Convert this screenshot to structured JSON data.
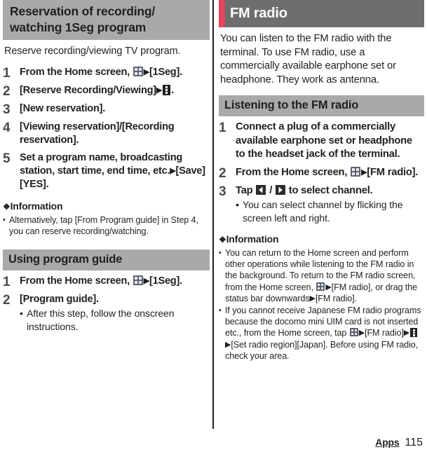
{
  "left": {
    "header": "Reservation of recording/ watching 1Seg program",
    "intro": "Reserve recording/viewing TV program.",
    "steps": [
      {
        "num": "1",
        "pre": "From the Home screen, ",
        "icon": "apps-grid-icon",
        "post": "[1Seg]."
      },
      {
        "num": "2",
        "pre": "[Reserve Recording/Viewing]",
        "icon": "overflow-menu-icon",
        "post": "."
      },
      {
        "num": "3",
        "pre": "[New reservation].",
        "icon": "",
        "post": ""
      },
      {
        "num": "4",
        "pre": "[Viewing reservation]/[Recording reservation].",
        "icon": "",
        "post": ""
      },
      {
        "num": "5",
        "pre": "Set a program name, broadcasting station, start time, end time, etc.",
        "icon": "",
        "post": "[Save][YES]."
      }
    ],
    "info_heading": "Information",
    "info_items": [
      "Alternatively, tap [From Program guide] in Step 4, you can reserve recording/watching."
    ],
    "subheader": "Using program guide",
    "guide_steps": [
      {
        "num": "1",
        "pre": "From the Home screen, ",
        "icon": "apps-grid-icon",
        "post": "[1Seg]."
      },
      {
        "num": "2",
        "pre": "[Program guide].",
        "icon": "",
        "post": "",
        "sub": "After this step, follow the onscreen instructions."
      }
    ]
  },
  "right": {
    "header": "FM radio",
    "intro": "You can listen to the FM radio with the terminal. To use FM radio, use a commercially available earphone set or headphone. They work as antenna.",
    "subheader": "Listening to the FM radio",
    "steps": [
      {
        "num": "1",
        "text": "Connect a plug of a commercially available earphone set or headphone to the headset jack of the terminal."
      },
      {
        "num": "2",
        "pre": "From the Home screen, ",
        "icon": "apps-grid-icon",
        "post": "[FM radio]."
      },
      {
        "num": "3",
        "pre": "Tap ",
        "mid": " / ",
        "post": " to select channel.",
        "sub": "You can select channel by flicking the screen left and right."
      }
    ],
    "info_heading": "Information",
    "info_items": [
      {
        "p1": "You can return to the Home screen and perform other operations while listening to the FM radio in the background. To return to the FM radio screen, from the Home screen, ",
        "p2": "[FM radio], or drag the status bar downwards",
        "p3": "[FM radio]."
      },
      {
        "p1": "If you cannot receive Japanese FM radio programs because the docomo mini UIM card is not inserted etc., from the Home screen, tap ",
        "p2": "[FM radio]",
        "p3": "[Set radio region][Japan]. Before using FM radio, check your area."
      }
    ]
  },
  "footer": {
    "section": "Apps",
    "page": "115"
  },
  "colors": {
    "header_gray": "#a9a9a9",
    "header_dark": "#6e6e6e",
    "accent_red": "#e2455c",
    "text": "#231f20"
  }
}
